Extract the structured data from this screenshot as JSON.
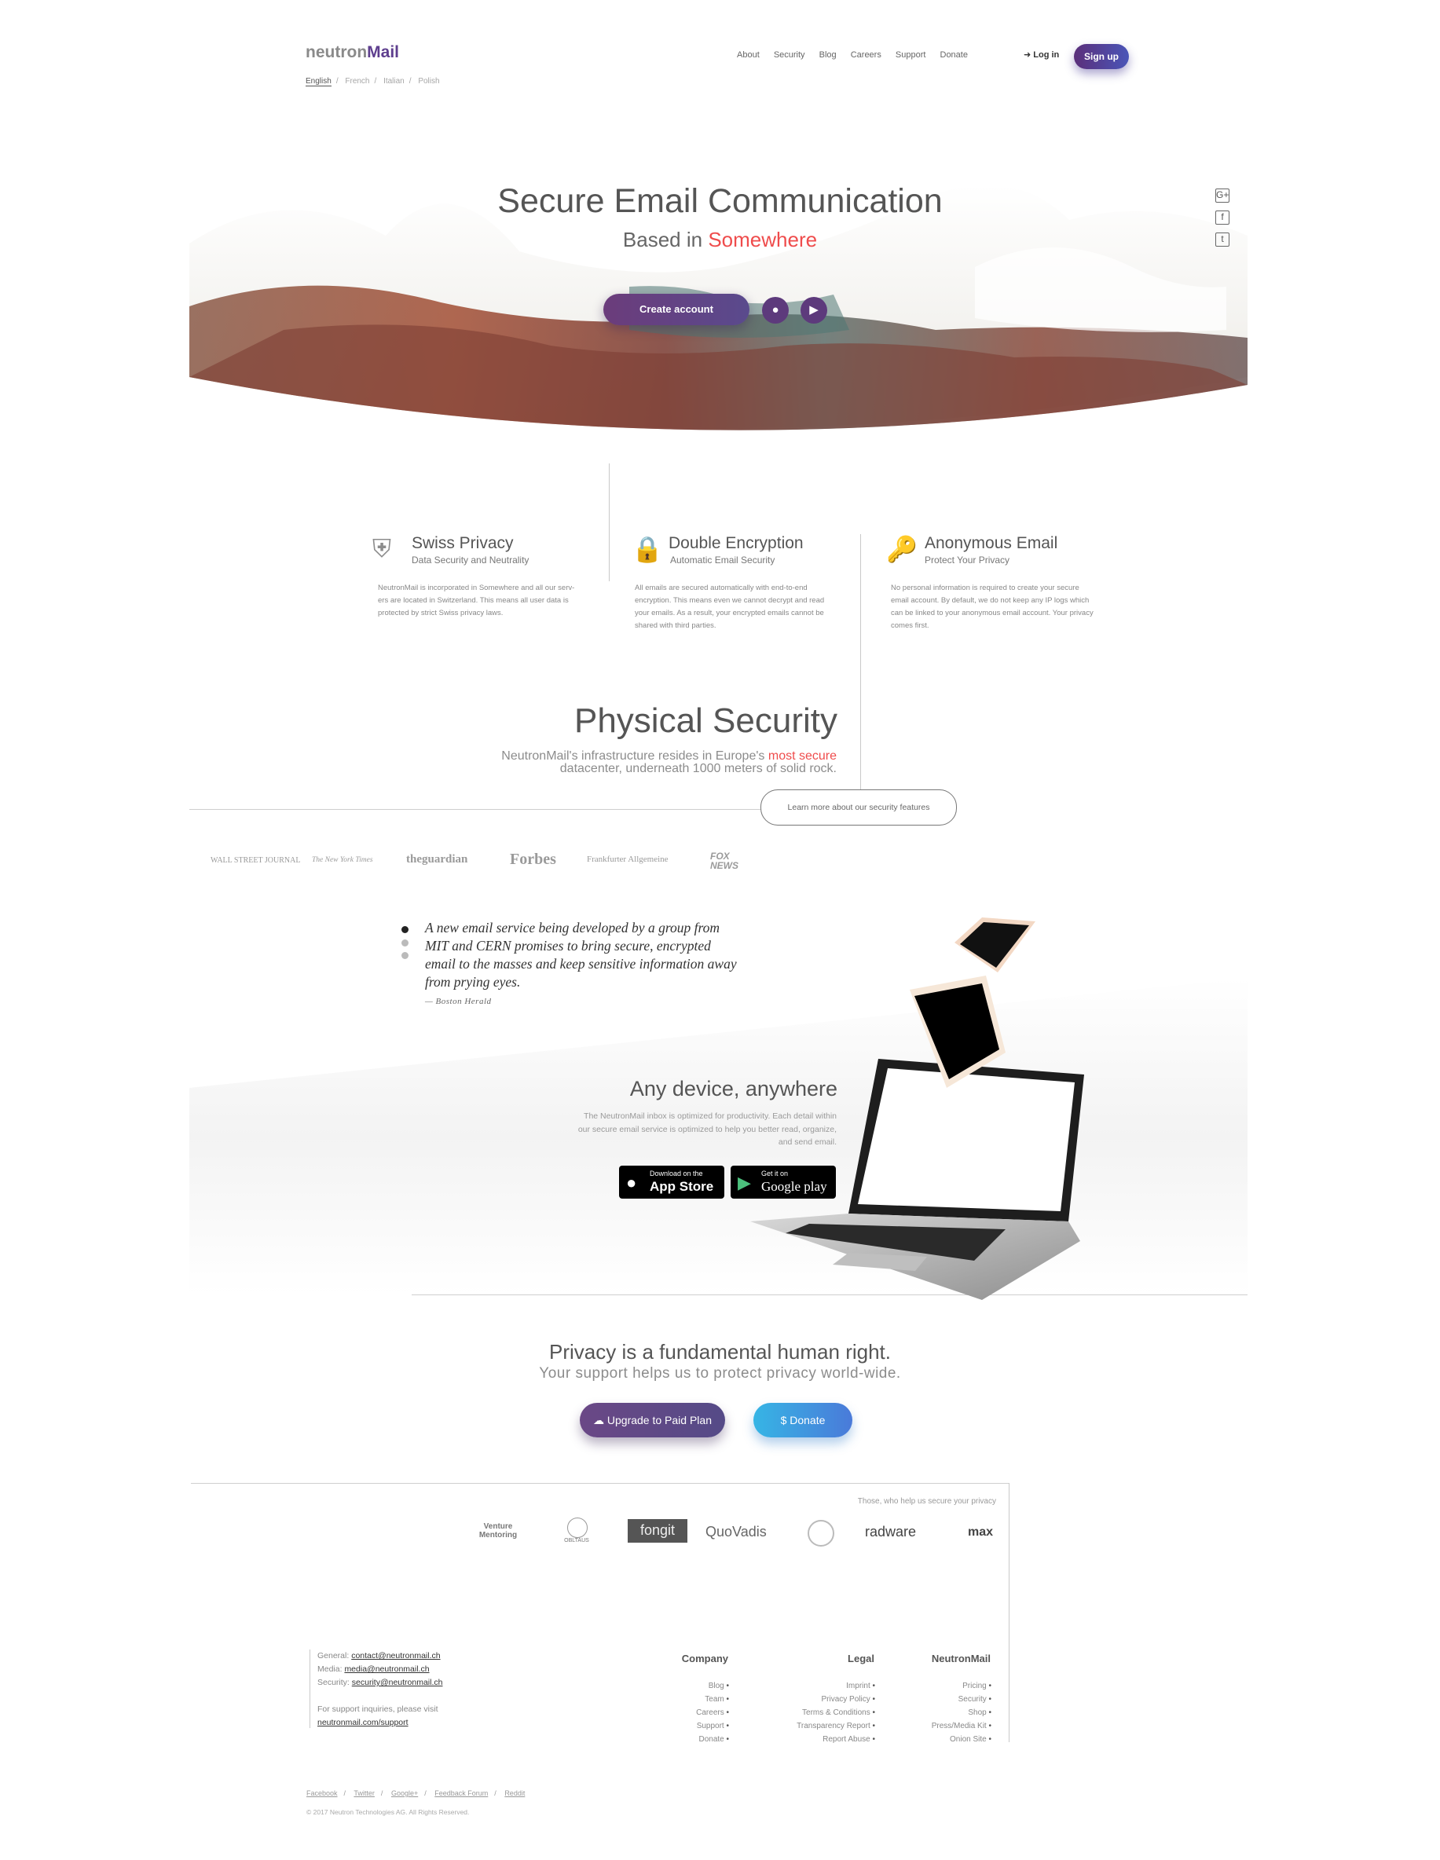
{
  "header": {
    "logo_neutron": "neutron",
    "logo_mail": "Mail",
    "languages": [
      "English",
      "French",
      "Italian",
      "Polish"
    ],
    "nav": [
      "About",
      "Security",
      "Blog",
      "Careers",
      "Support",
      "Donate"
    ],
    "login": "Log in",
    "signup": "Sign up"
  },
  "hero": {
    "title": "Secure Email Communication",
    "subtitle_prefix": "Based in ",
    "subtitle_highlight": "Somewhere",
    "create_account": "Create account",
    "social": [
      "G+",
      "f",
      "t"
    ]
  },
  "features": [
    {
      "icon": "shield-icon",
      "title": "Swiss Privacy",
      "subtitle": "Data Security and Neutrality",
      "text": "NeutronMail is incorporated in Somewhere and all our serv-ers are located in Switzerland. This means all user data is protected by strict Swiss privacy laws."
    },
    {
      "icon": "lock-icon",
      "title": "Double Encryption",
      "subtitle": "Automatic Email Security",
      "text": "All emails are secured automatically with end-to-end encryption. This means even we cannot decrypt and read your emails. As a result, your encrypted emails cannot be shared with third parties."
    },
    {
      "icon": "key-icon",
      "title": "Anonymous Email",
      "subtitle": "Protect Your Privacy",
      "text": "No personal information is required to create your secure email account. By default, we do not keep any IP logs which can be linked to your anonymous email account. Your privacy comes first."
    }
  ],
  "physical": {
    "title": "Physical Security",
    "line1_prefix": "NeutronMail's infrastructure resides in Europe's ",
    "line1_highlight": "most secure",
    "line2": "datacenter, underneath 1000 meters of solid rock.",
    "learn_more": "Learn more about our security features"
  },
  "press": [
    "WALL STREET JOURNAL",
    "The New York Times",
    "theguardian",
    "Forbes",
    "Frankfurter Allgemeine",
    "FOX NEWS"
  ],
  "quote": {
    "text": "A new email service being developed by a group from MIT and CERN promises to bring secure, encrypted email to the masses and keep sensitive information away from prying eyes.",
    "author": "— Boston Herald"
  },
  "devices": {
    "title": "Any device, anywhere",
    "text": "The NeutronMail inbox is optimized for productivity. Each detail within our secure email service is optimized to help you better read, organize, and send email.",
    "appstore_small": "Download on the",
    "appstore_big": "App Store",
    "googleplay_small": "Get it on",
    "googleplay_big": "Google play"
  },
  "privacy": {
    "title": "Privacy is a fundamental human right.",
    "subtitle": "Your support helps us to protect privacy world-wide.",
    "upgrade": "Upgrade to Paid Plan",
    "donate": "$ Donate"
  },
  "sponsors": {
    "caption": "Those, who help us secure your privacy",
    "names": [
      "Venture Mentoring",
      "OBLTAUS",
      "fongit",
      "QuoVadis",
      "seal",
      "radware",
      "max"
    ]
  },
  "footer": {
    "general_label": "General: ",
    "general_email": "contact@neutronmail.ch",
    "media_label": "Media: ",
    "media_email": "media@neutronmail.ch",
    "security_label": "Security: ",
    "security_email": "security@neutronmail.ch",
    "support_text": "For support inquiries, please visit",
    "support_link": "neutronmail.com/support",
    "company_title": "Company",
    "company": [
      "Blog",
      "Team",
      "Careers",
      "Support",
      "Donate"
    ],
    "legal_title": "Legal",
    "legal": [
      "Imprint",
      "Privacy Policy",
      "Terms & Conditions",
      "Transparency Report",
      "Report Abuse"
    ],
    "neutron_title": "NeutronMail",
    "neutron": [
      "Pricing",
      "Security",
      "Shop",
      "Press/Media Kit",
      "Onion Site"
    ],
    "social": [
      "Facebook",
      "Twitter",
      "Google+",
      "Feedback Forum",
      "Reddit"
    ],
    "copyright": "© 2017 Neutron Technologies AG. All Rights Reserved."
  }
}
